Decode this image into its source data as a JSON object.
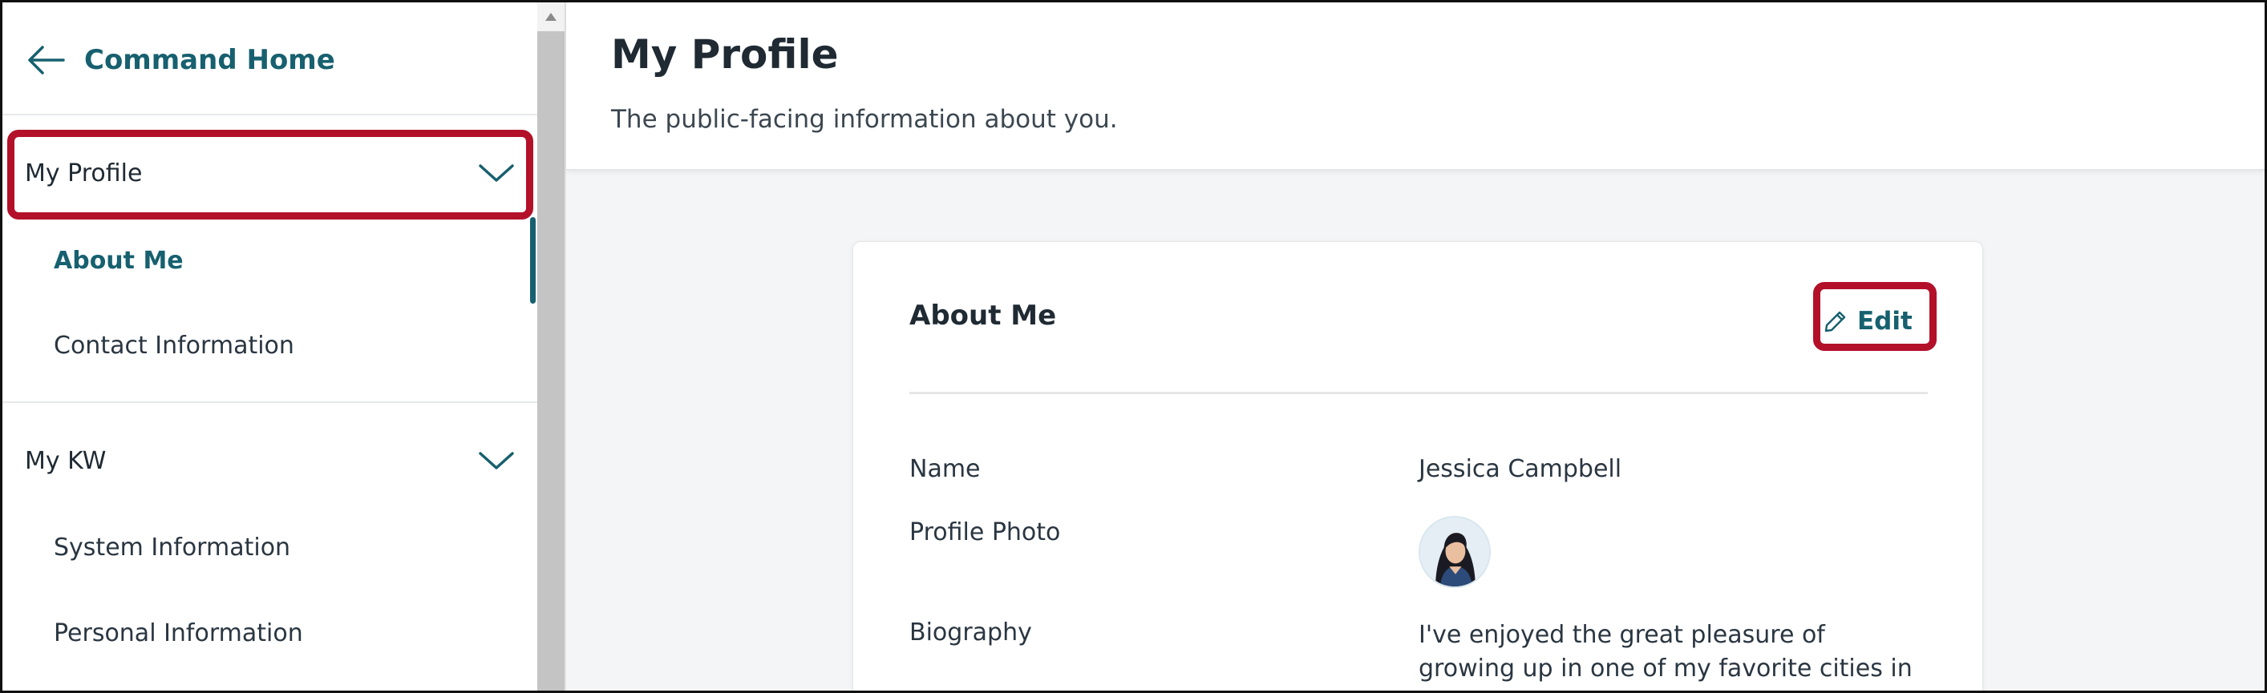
{
  "sidebar": {
    "back_link": {
      "label": "Command Home",
      "icon": "arrow-left-icon"
    },
    "sections": [
      {
        "label": "My Profile",
        "expanded": true,
        "highlighted": true,
        "items": [
          {
            "label": "About Me",
            "active": true
          },
          {
            "label": "Contact Information",
            "active": false
          }
        ]
      },
      {
        "label": "My KW",
        "expanded": true,
        "highlighted": false,
        "items": [
          {
            "label": "System Information",
            "active": false
          },
          {
            "label": "Personal Information",
            "active": false
          }
        ]
      }
    ]
  },
  "header": {
    "title": "My Profile",
    "subtitle": "The public-facing information about you."
  },
  "card": {
    "title": "About Me",
    "edit_label": "Edit",
    "edit_icon": "pencil-icon",
    "fields": {
      "name": {
        "label": "Name",
        "value": "Jessica Campbell"
      },
      "photo": {
        "label": "Profile Photo"
      },
      "biography": {
        "label": "Biography",
        "value": "I've enjoyed the great pleasure of growing up in one of my favorite cities in the world:"
      }
    }
  },
  "colors": {
    "accent": "#17606f",
    "highlight": "#b3102a",
    "main_background": "#f4f5f6",
    "scrollbar": "#c4c4c4"
  }
}
